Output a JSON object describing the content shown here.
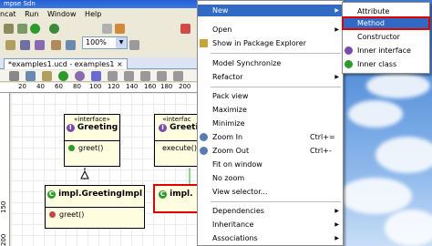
{
  "window": {
    "title": "mpse Sdn"
  },
  "menubar": [
    "ncat",
    "Run",
    "Window",
    "Help"
  ],
  "toolbar": {
    "zoom_value": "100%"
  },
  "editor": {
    "tab_label": "*examples1.ucd - examples1"
  },
  "ruler": {
    "top": [
      "20",
      "40",
      "60",
      "80",
      "100",
      "120",
      "140",
      "160",
      "180",
      "200"
    ],
    "left": [
      "150",
      "200"
    ]
  },
  "diagram": {
    "greeting": {
      "stereotype": "«interface»",
      "name": "Greeting",
      "op": "greet()"
    },
    "greeting2": {
      "stereotype": "«interfac",
      "name": "Greeti",
      "op": "execute()"
    },
    "impl1": {
      "name": "impl.GreetingImpl",
      "op": "greet()"
    },
    "impl2": {
      "name": "impl."
    }
  },
  "context_menu": {
    "items": [
      {
        "label": "New",
        "highlighted": true
      },
      {
        "label": "Open"
      },
      {
        "label": "Show in Package Explorer"
      },
      {
        "label": "Model Synchronize"
      },
      {
        "label": "Refactor"
      },
      {
        "label": "Pack view"
      },
      {
        "label": "Maximize"
      },
      {
        "label": "Minimize"
      },
      {
        "label": "Zoom In",
        "shortcut": "Ctrl+="
      },
      {
        "label": "Zoom Out",
        "shortcut": "Ctrl+-"
      },
      {
        "label": "Fit on window"
      },
      {
        "label": "No zoom"
      },
      {
        "label": "View selector..."
      },
      {
        "label": "Dependencies"
      },
      {
        "label": "Inheritance"
      },
      {
        "label": "Associations"
      }
    ]
  },
  "submenu": {
    "items": [
      {
        "label": "Attribute"
      },
      {
        "label": "Method",
        "highlighted": true
      },
      {
        "label": "Constructor"
      },
      {
        "label": "Inner interface"
      },
      {
        "label": "Inner class"
      }
    ]
  },
  "colors": {
    "highlight": "#316ac5",
    "red_frame": "#e00000"
  }
}
